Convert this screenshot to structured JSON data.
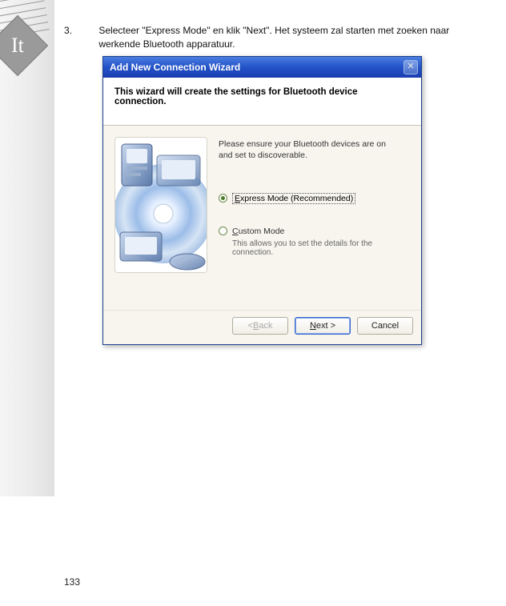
{
  "sidebar": {
    "badge": "It"
  },
  "step": {
    "number": "3.",
    "text": "Selecteer \"Express Mode\" en klik \"Next\". Het systeem zal starten met zoeken naar werkende Bluetooth apparatuur."
  },
  "wizard": {
    "title": "Add New Connection Wizard",
    "close_glyph": "✕",
    "heading": "This wizard will create the settings for Bluetooth device connection.",
    "intro": "Please ensure your Bluetooth devices are on and set to discoverable.",
    "option_express": {
      "prefix": "E",
      "rest": "xpress Mode (Recommended)",
      "selected": true
    },
    "option_custom": {
      "prefix": "C",
      "rest": "ustom Mode",
      "selected": false,
      "sub": "This allows you to set the details for the connection."
    },
    "buttons": {
      "back": {
        "prefix": "< ",
        "ul": "B",
        "rest": "ack"
      },
      "next": {
        "ul": "N",
        "rest": "ext >"
      },
      "cancel": {
        "label": "Cancel"
      }
    }
  },
  "page_number": "133"
}
